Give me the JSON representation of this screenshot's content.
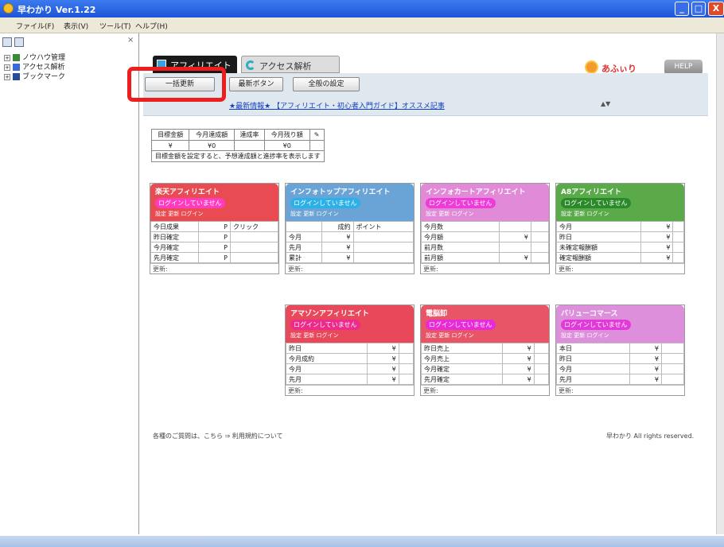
{
  "window": {
    "title": "早わかり Ver.1.22",
    "minimize": "_",
    "maximize": "□",
    "close": "X"
  },
  "menu": [
    "ファイル(F)",
    "表示(V)",
    "ツール(T)",
    "ヘルプ(H)"
  ],
  "tree": [
    "ノウハウ管理",
    "アクセス解析",
    "ブックマーク"
  ],
  "tabs": {
    "active": "アフィリエイト",
    "other": "アクセス解析"
  },
  "logo": "あふぃり",
  "help_button": "HELP",
  "toolbar": {
    "update_button": "一括更新",
    "reload_button": "最新ボタン",
    "settings_button": "全般の設定"
  },
  "news": {
    "text": "★最新情報★ 【アフィリエイト・初心者入門ガイド】オススメ記事",
    "nav": "▲▼"
  },
  "summary": {
    "headers": [
      "目標金額",
      "今月達成額",
      "達成率",
      "今月残り額"
    ],
    "values": [
      "¥",
      "¥0",
      "",
      "¥0"
    ],
    "note": "目標金額を設定すると、予想達成額と進捗率を表示します"
  },
  "panels": [
    {
      "name": "楽天アフィリエイト",
      "status": "ログインしていません",
      "links": "設定 更新 ログイン",
      "rows": [
        [
          "今日成果",
          "P"
        ],
        [
          "昨日確定",
          "P"
        ],
        [
          "今月確定",
          "P"
        ],
        [
          "先月確定",
          "P"
        ]
      ],
      "col3": "クリック",
      "update": "更新:"
    },
    {
      "name": "インフォトップアフィリエイト",
      "status": "ログインしていません",
      "links": "設定 更新 ログイン",
      "rows": [
        [
          "",
          "成約"
        ],
        [
          "今月",
          "¥"
        ],
        [
          "先月",
          "¥"
        ],
        [
          "累計",
          "¥"
        ]
      ],
      "col3": "ポイント",
      "update": "更新:"
    },
    {
      "name": "インフォカートアフィリエイト",
      "status": "ログインしていません",
      "links": "設定 更新 ログイン",
      "rows": [
        [
          "今月数",
          ""
        ],
        [
          "今月額",
          "¥"
        ],
        [
          "前月数",
          ""
        ],
        [
          "前月額",
          "¥"
        ]
      ],
      "col3": "",
      "update": "更新:"
    },
    {
      "name": "A8アフィリエイト",
      "status": "ログインしていません",
      "links": "設定 更新 ログイン",
      "rows": [
        [
          "今月",
          "¥"
        ],
        [
          "昨日",
          "¥"
        ],
        [
          "未確定報酬額",
          "¥"
        ],
        [
          "確定報酬額",
          "¥"
        ]
      ],
      "col3": "",
      "update": "更新:"
    },
    {
      "name": "アマゾンアフィリエイト",
      "status": "ログインしていません",
      "links": "設定 更新 ログイン",
      "rows": [
        [
          "昨日",
          "¥"
        ],
        [
          "今月成約",
          "¥"
        ],
        [
          "今月",
          "¥"
        ],
        [
          "先月",
          "¥"
        ]
      ],
      "col3": "",
      "update": "更新:"
    },
    {
      "name": "電脳卸",
      "status": "ログインしていません",
      "links": "設定 更新 ログイン",
      "rows": [
        [
          "昨日売上",
          "¥"
        ],
        [
          "今月売上",
          "¥"
        ],
        [
          "今月確定",
          "¥"
        ],
        [
          "先月確定",
          "¥"
        ]
      ],
      "col3": "",
      "update": "更新:"
    },
    {
      "name": "バリューコマース",
      "status": "ログインしていません",
      "links": "設定 更新 ログイン",
      "rows": [
        [
          "本日",
          "¥"
        ],
        [
          "昨日",
          "¥"
        ],
        [
          "今月",
          "¥"
        ],
        [
          "先月",
          "¥"
        ]
      ],
      "col3": "",
      "update": "更新:"
    }
  ],
  "footer": {
    "note": "各種のご質問は、こちら ⇒ 利用規約について",
    "copyright": "早わかり All rights reserved."
  },
  "colors": {
    "rakuten": "#e94b52",
    "infotop": "#6aa3d6",
    "infocart": "#e08ad8",
    "a8": "#5aaa4a",
    "amazon": "#e8485a",
    "dennou": "#e85566",
    "value": "#dd8fdc"
  }
}
